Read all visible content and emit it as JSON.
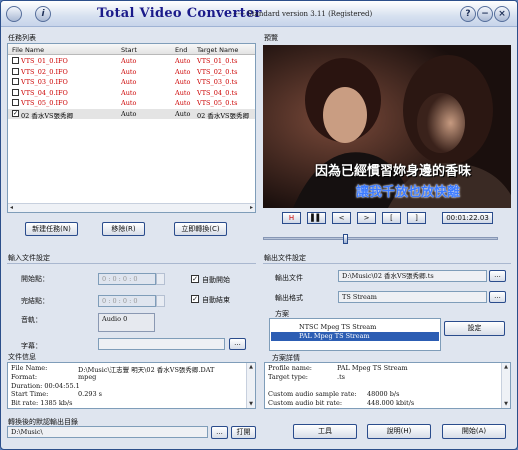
{
  "app": {
    "title": "Total Video Converter",
    "version": "----- Standard version 3.11 (Registered)"
  },
  "titlebar": {
    "info_icon": "i",
    "help": "?",
    "minimize": "−",
    "close": "×"
  },
  "tasks": {
    "label": "任務列表",
    "columns": [
      "File Name",
      "Start",
      "End",
      "Target Name"
    ],
    "rows": [
      {
        "checked": false,
        "name": "VTS_01_0.IFO",
        "start": "Auto",
        "end": "Auto",
        "target": "VTS_01_0.ts",
        "selected": false
      },
      {
        "checked": false,
        "name": "VTS_02_0.IFO",
        "start": "Auto",
        "end": "Auto",
        "target": "VTS_02_0.ts",
        "selected": false
      },
      {
        "checked": false,
        "name": "VTS_03_0.IFO",
        "start": "Auto",
        "end": "Auto",
        "target": "VTS_03_0.ts",
        "selected": false
      },
      {
        "checked": false,
        "name": "VTS_04_0.IFO",
        "start": "Auto",
        "end": "Auto",
        "target": "VTS_04_0.ts",
        "selected": false
      },
      {
        "checked": false,
        "name": "VTS_05_0.IFO",
        "start": "Auto",
        "end": "Auto",
        "target": "VTS_05_0.ts",
        "selected": false
      },
      {
        "checked": true,
        "name": "02 香水VS張秀卿",
        "start": "Auto",
        "end": "Auto",
        "target": "02 香水VS張秀卿",
        "selected": true
      }
    ],
    "buttons": {
      "new": "新建任務(N)",
      "remove": "移除(R)",
      "convert_now": "立即轉換(C)"
    }
  },
  "preview": {
    "label": "預覽",
    "subtitle1": "因為已經慣習妳身邊的香味",
    "subtitle2": "讓我千放也放快離",
    "controls": [
      "H",
      "▌▌",
      "<",
      ">",
      "[",
      "]"
    ],
    "timecode": "00:01:22.03",
    "progress": 0.34
  },
  "input": {
    "label": "輸入文件設定",
    "start_label": "開始點：",
    "end_label": "完結點：",
    "auto_start": "自動開始",
    "auto_end": "自動結束",
    "audio_label": "音軌：",
    "audio_value": "Audio 0",
    "subtitle_label": "字幕：",
    "timefield": "0 : 0 : 0 : 0",
    "file_info_label": "文件信息",
    "file_info": [
      {
        "k": "File Name:",
        "v": "D:\\Music\\江志豐 明天\\02 香水VS張秀卿.DAT"
      },
      {
        "k": "Format:",
        "v": "mpeg"
      },
      {
        "k": "Duration: 00:04:55.1",
        "v": ""
      },
      {
        "k": "Start Time:",
        "v": "0.293  s"
      },
      {
        "k": "Bit rate:   1385  kb/s",
        "v": ""
      }
    ]
  },
  "output": {
    "label": "輸出文件設定",
    "file_label": "輸出文件",
    "file_value": "D:\\Music\\02 香水VS張秀卿.ts",
    "format_label": "輸出格式",
    "format_value": "TS Stream",
    "scheme_label": "方案",
    "schemes": [
      "NTSC Mpeg TS Stream",
      "PAL Mpeg TS Stream"
    ],
    "selected_scheme": 1,
    "settings_button": "設定",
    "detail_label": "方案詳情",
    "details": [
      {
        "k": "Profile name:",
        "v": "PAL Mpeg TS Stream"
      },
      {
        "k": "Target type:",
        "v": ".ts"
      },
      {
        "k": "",
        "v": ""
      },
      {
        "k": "Custom audio sample rate:",
        "v": "48000 b/s"
      },
      {
        "k": "Custom audio bit rate:",
        "v": "448.000 kbit/s"
      }
    ]
  },
  "bottom": {
    "default_dir_label": "轉換後的默認輸出目錄",
    "default_dir": "D:\\Music\\",
    "browse": "...",
    "open": "打開",
    "tools": "工具",
    "help": "說明(H)",
    "start": "開始(A)"
  }
}
